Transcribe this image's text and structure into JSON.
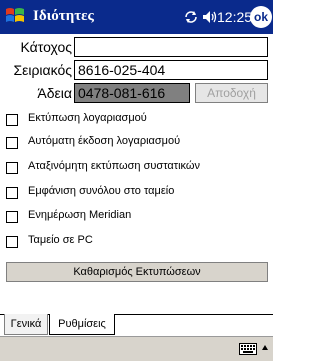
{
  "title": "Ιδιότητες",
  "time": "12:25",
  "ok_label": "ok",
  "fields": {
    "holder_label": "Κάτοχος",
    "holder_value": "",
    "serial_label": "Σειριακός",
    "serial_value": "8616-025-404",
    "license_label": "Άδεια",
    "license_value": "0478-081-616",
    "accept_label": "Αποδοχή"
  },
  "options": [
    {
      "label": "Εκτύπωση λογαριασμού",
      "checked": false
    },
    {
      "label": "Αυτόματη έκδοση λογαριασμού",
      "checked": false
    },
    {
      "label": "Αταξινόμητη εκτύπωση συστατικών",
      "checked": false
    },
    {
      "label": "Εμφάνιση συνόλου στο ταμείο",
      "checked": false
    },
    {
      "label": "Ενημέρωση Meridian",
      "checked": false
    },
    {
      "label": "Ταμείο σε PC",
      "checked": false
    }
  ],
  "clear_button": "Καθαρισμός Εκτυπώσεων",
  "tabs": [
    {
      "label": "Γενικά",
      "selected": false
    },
    {
      "label": "Ρυθμίσεις",
      "selected": true
    }
  ],
  "icons": {
    "logo": "windows-flag-icon",
    "sync": "sync-icon",
    "volume": "volume-icon",
    "keyboard": "keyboard-icon",
    "caret": "input-menu-caret-icon"
  },
  "colors": {
    "titlebar": "#0a2a8c",
    "disabled_field": "#808080"
  }
}
